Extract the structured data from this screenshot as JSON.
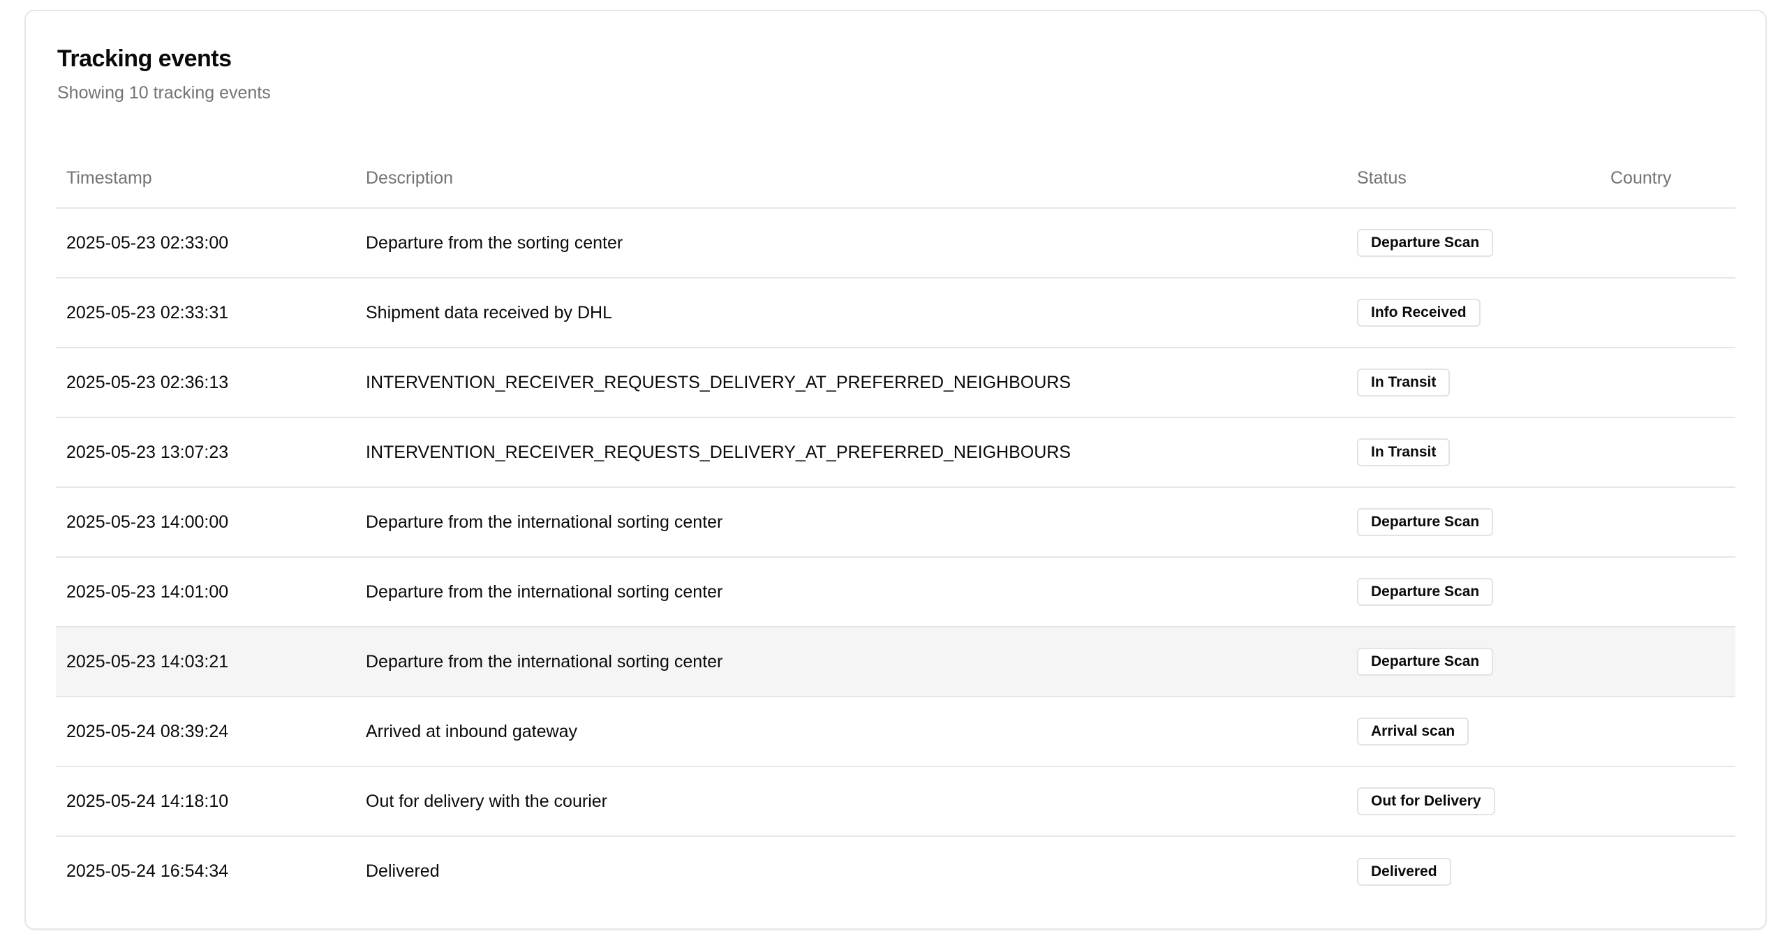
{
  "card": {
    "title": "Tracking events",
    "subtitle": "Showing 10 tracking events"
  },
  "table": {
    "columns": [
      "Timestamp",
      "Description",
      "Status",
      "Country"
    ],
    "rows": [
      {
        "timestamp": "2025-05-23 02:33:00",
        "description": "Departure from the sorting center",
        "status": "Departure Scan",
        "country": ""
      },
      {
        "timestamp": "2025-05-23 02:33:31",
        "description": "Shipment data received by DHL",
        "status": "Info Received",
        "country": ""
      },
      {
        "timestamp": "2025-05-23 02:36:13",
        "description": "INTERVENTION_RECEIVER_REQUESTS_DELIVERY_AT_PREFERRED_NEIGHBOURS",
        "status": "In Transit",
        "country": ""
      },
      {
        "timestamp": "2025-05-23 13:07:23",
        "description": "INTERVENTION_RECEIVER_REQUESTS_DELIVERY_AT_PREFERRED_NEIGHBOURS",
        "status": "In Transit",
        "country": ""
      },
      {
        "timestamp": "2025-05-23 14:00:00",
        "description": "Departure from the international sorting center",
        "status": "Departure Scan",
        "country": ""
      },
      {
        "timestamp": "2025-05-23 14:01:00",
        "description": "Departure from the international sorting center",
        "status": "Departure Scan",
        "country": ""
      },
      {
        "timestamp": "2025-05-23 14:03:21",
        "description": "Departure from the international sorting center",
        "status": "Departure Scan",
        "country": ""
      },
      {
        "timestamp": "2025-05-24 08:39:24",
        "description": "Arrived at inbound gateway",
        "status": "Arrival scan",
        "country": ""
      },
      {
        "timestamp": "2025-05-24 14:18:10",
        "description": "Out for delivery with the courier",
        "status": "Out for Delivery",
        "country": ""
      },
      {
        "timestamp": "2025-05-24 16:54:34",
        "description": "Delivered",
        "status": "Delivered",
        "country": ""
      }
    ],
    "hovered_row_index": 6
  },
  "colors": {
    "border": "#e6e6e6",
    "muted_text": "#737373",
    "hover_row": "#f5f5f5"
  }
}
